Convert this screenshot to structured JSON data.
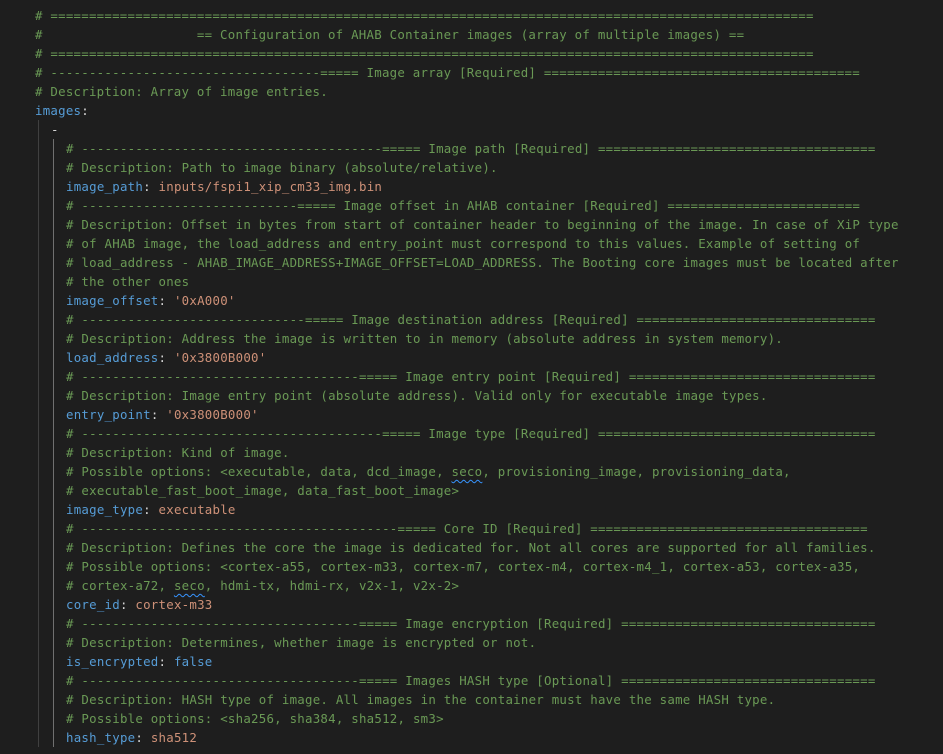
{
  "lines": [
    {
      "indent": 0,
      "parts": [
        {
          "t": "c",
          "v": "# ==================================================================================================="
        }
      ]
    },
    {
      "indent": 0,
      "parts": [
        {
          "t": "c",
          "v": "#                    == Configuration of AHAB Container images (array of multiple images) =="
        }
      ]
    },
    {
      "indent": 0,
      "parts": [
        {
          "t": "c",
          "v": "# ==================================================================================================="
        }
      ]
    },
    {
      "indent": 0,
      "parts": [
        {
          "t": "c",
          "v": "# -----------------------------------===== Image array [Required] ========================================="
        }
      ]
    },
    {
      "indent": 0,
      "parts": [
        {
          "t": "c",
          "v": "# Description: Array of image entries."
        }
      ]
    },
    {
      "indent": 0,
      "parts": [
        {
          "t": "k",
          "v": "images"
        },
        {
          "t": "p",
          "v": ":"
        }
      ]
    },
    {
      "indent": 1,
      "parts": [
        {
          "t": "p",
          "v": "-"
        }
      ]
    },
    {
      "indent": 2,
      "parts": [
        {
          "t": "c",
          "v": "# ---------------------------------------===== Image path [Required] ===================================="
        }
      ]
    },
    {
      "indent": 2,
      "parts": [
        {
          "t": "c",
          "v": "# Description: Path to image binary (absolute/relative)."
        }
      ]
    },
    {
      "indent": 2,
      "parts": [
        {
          "t": "k",
          "v": "image_path"
        },
        {
          "t": "p",
          "v": ": "
        },
        {
          "t": "s",
          "v": "inputs/fspi1_xip_cm33_img.bin"
        }
      ]
    },
    {
      "indent": 2,
      "parts": [
        {
          "t": "c",
          "v": "# ----------------------------===== Image offset in AHAB container [Required] ========================="
        }
      ]
    },
    {
      "indent": 2,
      "parts": [
        {
          "t": "c",
          "v": "# Description: Offset in bytes from start of container header to beginning of the image. In case of XiP type"
        }
      ]
    },
    {
      "indent": 2,
      "parts": [
        {
          "t": "c",
          "v": "# of AHAB image, the load_address and entry_point must correspond to this values. Example of setting of"
        }
      ]
    },
    {
      "indent": 2,
      "parts": [
        {
          "t": "c",
          "v": "# load_address - AHAB_IMAGE_ADDRESS+IMAGE_OFFSET=LOAD_ADDRESS. The Booting core images must be located after"
        }
      ]
    },
    {
      "indent": 2,
      "parts": [
        {
          "t": "c",
          "v": "# the other ones"
        }
      ]
    },
    {
      "indent": 2,
      "parts": [
        {
          "t": "k",
          "v": "image_offset"
        },
        {
          "t": "p",
          "v": ": "
        },
        {
          "t": "s",
          "v": "'0xA000'"
        }
      ]
    },
    {
      "indent": 2,
      "parts": [
        {
          "t": "c",
          "v": "# -----------------------------===== Image destination address [Required] ==============================="
        }
      ]
    },
    {
      "indent": 2,
      "parts": [
        {
          "t": "c",
          "v": "# Description: Address the image is written to in memory (absolute address in system memory)."
        }
      ]
    },
    {
      "indent": 2,
      "parts": [
        {
          "t": "k",
          "v": "load_address"
        },
        {
          "t": "p",
          "v": ": "
        },
        {
          "t": "s",
          "v": "'0x3800B000'"
        }
      ]
    },
    {
      "indent": 2,
      "parts": [
        {
          "t": "c",
          "v": "# ------------------------------------===== Image entry point [Required] ================================"
        }
      ]
    },
    {
      "indent": 2,
      "parts": [
        {
          "t": "c",
          "v": "# Description: Image entry point (absolute address). Valid only for executable image types."
        }
      ]
    },
    {
      "indent": 2,
      "parts": [
        {
          "t": "k",
          "v": "entry_point"
        },
        {
          "t": "p",
          "v": ": "
        },
        {
          "t": "s",
          "v": "'0x3800B000'"
        }
      ]
    },
    {
      "indent": 2,
      "parts": [
        {
          "t": "c",
          "v": "# ---------------------------------------===== Image type [Required] ===================================="
        }
      ]
    },
    {
      "indent": 2,
      "parts": [
        {
          "t": "c",
          "v": "# Description: Kind of image."
        }
      ]
    },
    {
      "indent": 2,
      "parts": [
        {
          "t": "c",
          "v": "# Possible options: <executable, data, dcd_image, "
        },
        {
          "t": "c",
          "v": "seco",
          "sq": true
        },
        {
          "t": "c",
          "v": ", provisioning_image, provisioning_data,"
        }
      ]
    },
    {
      "indent": 2,
      "parts": [
        {
          "t": "c",
          "v": "# executable_fast_boot_image, data_fast_boot_image>"
        }
      ]
    },
    {
      "indent": 2,
      "parts": [
        {
          "t": "k",
          "v": "image_type"
        },
        {
          "t": "p",
          "v": ": "
        },
        {
          "t": "s",
          "v": "executable"
        }
      ]
    },
    {
      "indent": 2,
      "parts": [
        {
          "t": "c",
          "v": "# -----------------------------------------===== Core ID [Required] ===================================="
        }
      ]
    },
    {
      "indent": 2,
      "parts": [
        {
          "t": "c",
          "v": "# Description: Defines the core the image is dedicated for. Not all cores are supported for all families."
        }
      ]
    },
    {
      "indent": 2,
      "parts": [
        {
          "t": "c",
          "v": "# Possible options: <cortex-a55, cortex-m33, cortex-m7, cortex-m4, cortex-m4_1, cortex-a53, cortex-a35,"
        }
      ]
    },
    {
      "indent": 2,
      "parts": [
        {
          "t": "c",
          "v": "# cortex-a72, "
        },
        {
          "t": "c",
          "v": "seco",
          "sq": true
        },
        {
          "t": "c",
          "v": ", hdmi-tx, hdmi-rx, v2x-1, v2x-2>"
        }
      ]
    },
    {
      "indent": 2,
      "parts": [
        {
          "t": "k",
          "v": "core_id"
        },
        {
          "t": "p",
          "v": ": "
        },
        {
          "t": "s",
          "v": "cortex-m33"
        }
      ]
    },
    {
      "indent": 2,
      "parts": [
        {
          "t": "c",
          "v": "# ------------------------------------===== Image encryption [Required] ================================="
        }
      ]
    },
    {
      "indent": 2,
      "parts": [
        {
          "t": "c",
          "v": "# Description: Determines, whether image is encrypted or not."
        }
      ]
    },
    {
      "indent": 2,
      "parts": [
        {
          "t": "k",
          "v": "is_encrypted"
        },
        {
          "t": "p",
          "v": ": "
        },
        {
          "t": "k",
          "v": "false"
        }
      ]
    },
    {
      "indent": 2,
      "parts": [
        {
          "t": "c",
          "v": "# ------------------------------------===== Images HASH type [Optional] ================================="
        }
      ]
    },
    {
      "indent": 2,
      "parts": [
        {
          "t": "c",
          "v": "# Description: HASH type of image. All images in the container must have the same HASH type."
        }
      ]
    },
    {
      "indent": 2,
      "parts": [
        {
          "t": "c",
          "v": "# Possible options: <sha256, sha384, sha512, sm3>"
        }
      ]
    },
    {
      "indent": 2,
      "parts": [
        {
          "t": "k",
          "v": "hash_type"
        },
        {
          "t": "p",
          "v": ": "
        },
        {
          "t": "s",
          "v": "sha512"
        }
      ]
    }
  ],
  "colors": {
    "background": "#1e1e1e",
    "comment": "#6a9955",
    "key": "#569cd6",
    "string": "#ce9178",
    "punctuation": "#d4d4d4"
  }
}
